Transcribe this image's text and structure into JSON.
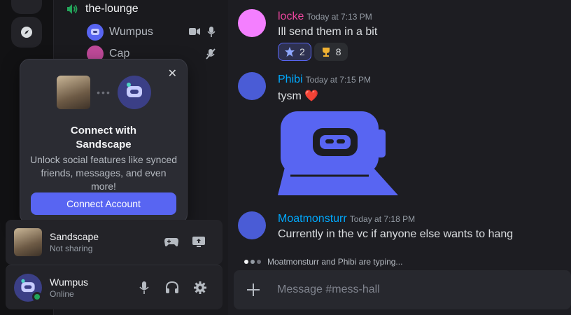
{
  "voice": {
    "channel_name": "the-lounge",
    "participants": [
      {
        "name": "Wumpus"
      },
      {
        "name": "Cap"
      }
    ]
  },
  "popup": {
    "title": "Connect with Sandscape",
    "description": "Unlock social features like synced friends, messages, and even more!",
    "button_label": "Connect Account",
    "close_label": "✕"
  },
  "activity_panel": {
    "game_name": "Sandscape",
    "status": "Not sharing"
  },
  "user_panel": {
    "username": "Wumpus",
    "status": "Online"
  },
  "messages": [
    {
      "author": "locke",
      "author_color": "#eb459e",
      "time": "Today at 7:13 PM",
      "text": "Ill send them in a bit"
    },
    {
      "author": "Phibi",
      "author_color": "#00a8fc",
      "time": "Today at 7:15 PM",
      "text": "tysm ❤️"
    },
    {
      "author": "Moatmonsturr",
      "author_color": "#00a8fc",
      "time": "Today at 7:18 PM",
      "text": "Currently in the vc if anyone else wants to hang"
    }
  ],
  "reactions": [
    {
      "emoji": "star-icon",
      "count": "2",
      "active": true
    },
    {
      "emoji": "trophy-icon",
      "count": "8",
      "active": false
    }
  ],
  "typing_indicator": "Moatmonsturr and Phibi are typing...",
  "composer": {
    "placeholder": "Message #mess-hall"
  },
  "colors": {
    "accent": "#5865f2",
    "online": "#23a55a",
    "speaker": "#23a55a"
  }
}
